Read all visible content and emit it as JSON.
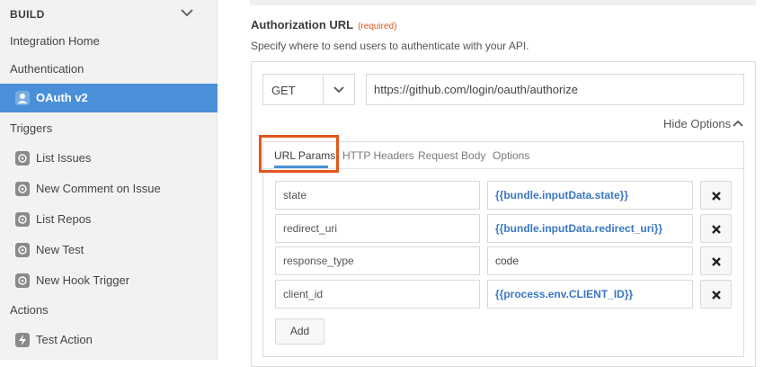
{
  "sidebar": {
    "section_label": "BUILD",
    "integration_home": "Integration Home",
    "authentication": "Authentication",
    "active_item": "OAuth v2",
    "triggers_heading": "Triggers",
    "triggers": [
      "List Issues",
      "New Comment on Issue",
      "List Repos",
      "New Test",
      "New Hook Trigger"
    ],
    "actions_heading": "Actions",
    "actions": [
      "Test Action"
    ]
  },
  "main": {
    "title": "Authorization URL",
    "required": "(required)",
    "description": "Specify where to send users to authenticate with your API.",
    "method": "GET",
    "url": "https://github.com/login/oauth/authorize",
    "hide_options": "Hide Options",
    "tabs": [
      "URL Params",
      "HTTP Headers",
      "Request Body",
      "Options"
    ],
    "active_tab": "URL Params",
    "params": [
      {
        "key": "state",
        "value": "{{bundle.inputData.state}}"
      },
      {
        "key": "redirect_uri",
        "value": "{{bundle.inputData.redirect_uri}}"
      },
      {
        "key": "response_type",
        "value": "code"
      },
      {
        "key": "client_id",
        "value": "{{process.env.CLIENT_ID}}"
      }
    ],
    "add_button": "Add"
  },
  "colors": {
    "accent": "#4a90d9",
    "required": "#e5551b",
    "template_text": "#3a78c3",
    "highlight_box": "#e5551b"
  },
  "icons": {
    "collapse": "chevron-up-icon",
    "trigger": "trigger-icon",
    "action": "lightning-icon",
    "auth": "person-icon",
    "delete": "close-icon"
  }
}
